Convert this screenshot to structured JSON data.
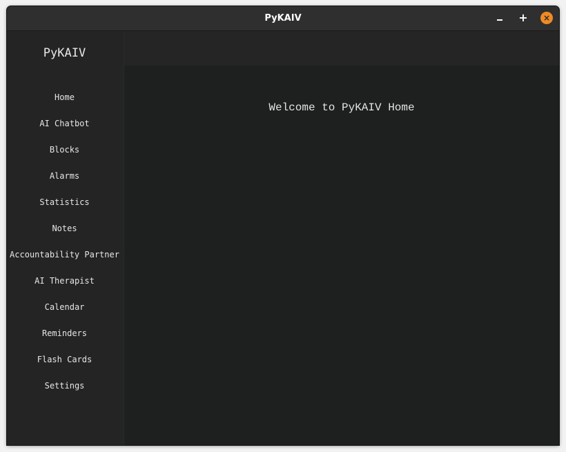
{
  "window": {
    "title": "PyKAIV",
    "controls": {
      "minimize_icon": "minimize-icon",
      "maximize_symbol": "+",
      "close_symbol": "×",
      "close_color": "#f08a24"
    }
  },
  "sidebar": {
    "title": "PyKAIV",
    "items": [
      {
        "label": "Home"
      },
      {
        "label": "AI Chatbot"
      },
      {
        "label": "Blocks"
      },
      {
        "label": "Alarms"
      },
      {
        "label": "Statistics"
      },
      {
        "label": "Notes"
      },
      {
        "label": "Accountability Partner"
      },
      {
        "label": "AI Therapist"
      },
      {
        "label": "Calendar"
      },
      {
        "label": "Reminders"
      },
      {
        "label": "Flash Cards"
      },
      {
        "label": "Settings"
      }
    ]
  },
  "main": {
    "welcome_text": "Welcome to PyKAIV Home"
  }
}
